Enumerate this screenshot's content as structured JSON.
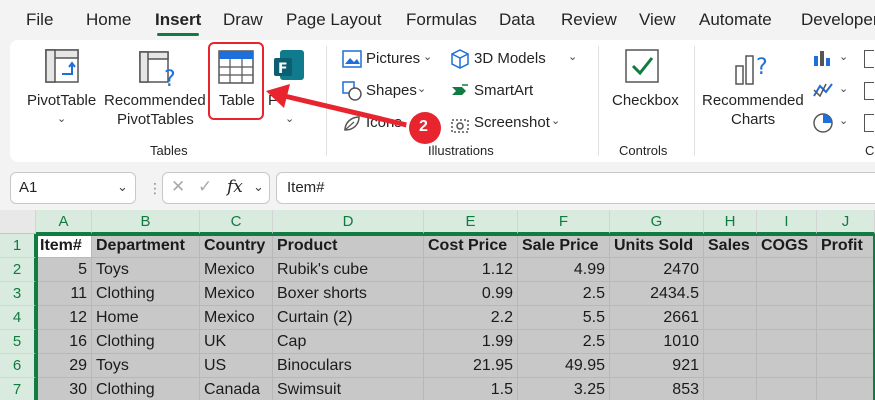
{
  "tabs": [
    "File",
    "Home",
    "Insert",
    "Draw",
    "Page Layout",
    "Formulas",
    "Data",
    "Review",
    "View",
    "Automate",
    "Developer"
  ],
  "active_tab": "Insert",
  "ribbon": {
    "tables_group": {
      "pivottable": "PivotTable",
      "recommended_pivottables_line1": "Recommended",
      "recommended_pivottables_line2": "PivotTables",
      "table": "Table",
      "forms_partial": "F",
      "label": "Tables"
    },
    "illustrations_group": {
      "pictures": "Pictures",
      "shapes": "Shapes",
      "icons": "Icons",
      "models_3d": "3D Models",
      "smartart": "SmartArt",
      "screenshot": "Screenshot",
      "label": "Illustrations"
    },
    "controls_group": {
      "checkbox": "Checkbox",
      "label": "Controls"
    },
    "charts_group": {
      "recommended_charts_line1": "Recommended",
      "recommended_charts_line2": "Charts",
      "label_partial": "C"
    },
    "annotation": {
      "step_number": "2",
      "highlight_color": "#e8252e"
    }
  },
  "formula_bar": {
    "name_box": "A1",
    "fx_label": "fx",
    "content": "Item#"
  },
  "sheet": {
    "columns": [
      "A",
      "B",
      "C",
      "D",
      "E",
      "F",
      "G",
      "H",
      "I",
      "J"
    ],
    "row_numbers": [
      "1",
      "2",
      "3",
      "4",
      "5",
      "6",
      "7"
    ],
    "rows": [
      [
        "Item#",
        "Department",
        "Country",
        "Product",
        "Cost Price",
        "Sale Price",
        "Units Sold",
        "Sales",
        "COGS",
        "Profit"
      ],
      [
        "5",
        "Toys",
        "Mexico",
        "Rubik's cube",
        "1.12",
        "4.99",
        "2470",
        "",
        "",
        ""
      ],
      [
        "11",
        "Clothing",
        "Mexico",
        "Boxer shorts",
        "0.99",
        "2.5",
        "2434.5",
        "",
        "",
        ""
      ],
      [
        "12",
        "Home",
        "Mexico",
        "Curtain (2)",
        "2.2",
        "5.5",
        "2661",
        "",
        "",
        ""
      ],
      [
        "16",
        "Clothing",
        "UK",
        "Cap",
        "1.99",
        "2.5",
        "1010",
        "",
        "",
        ""
      ],
      [
        "29",
        "Toys",
        "US",
        "Binoculars",
        "21.95",
        "49.95",
        "921",
        "",
        "",
        ""
      ],
      [
        "30",
        "Clothing",
        "Canada",
        "Swimsuit",
        "1.5",
        "3.25",
        "853",
        "",
        "",
        ""
      ]
    ]
  },
  "colors": {
    "accent": "#107c41",
    "selection_fill": "#c8c8c8",
    "annotation": "#e8252e"
  }
}
